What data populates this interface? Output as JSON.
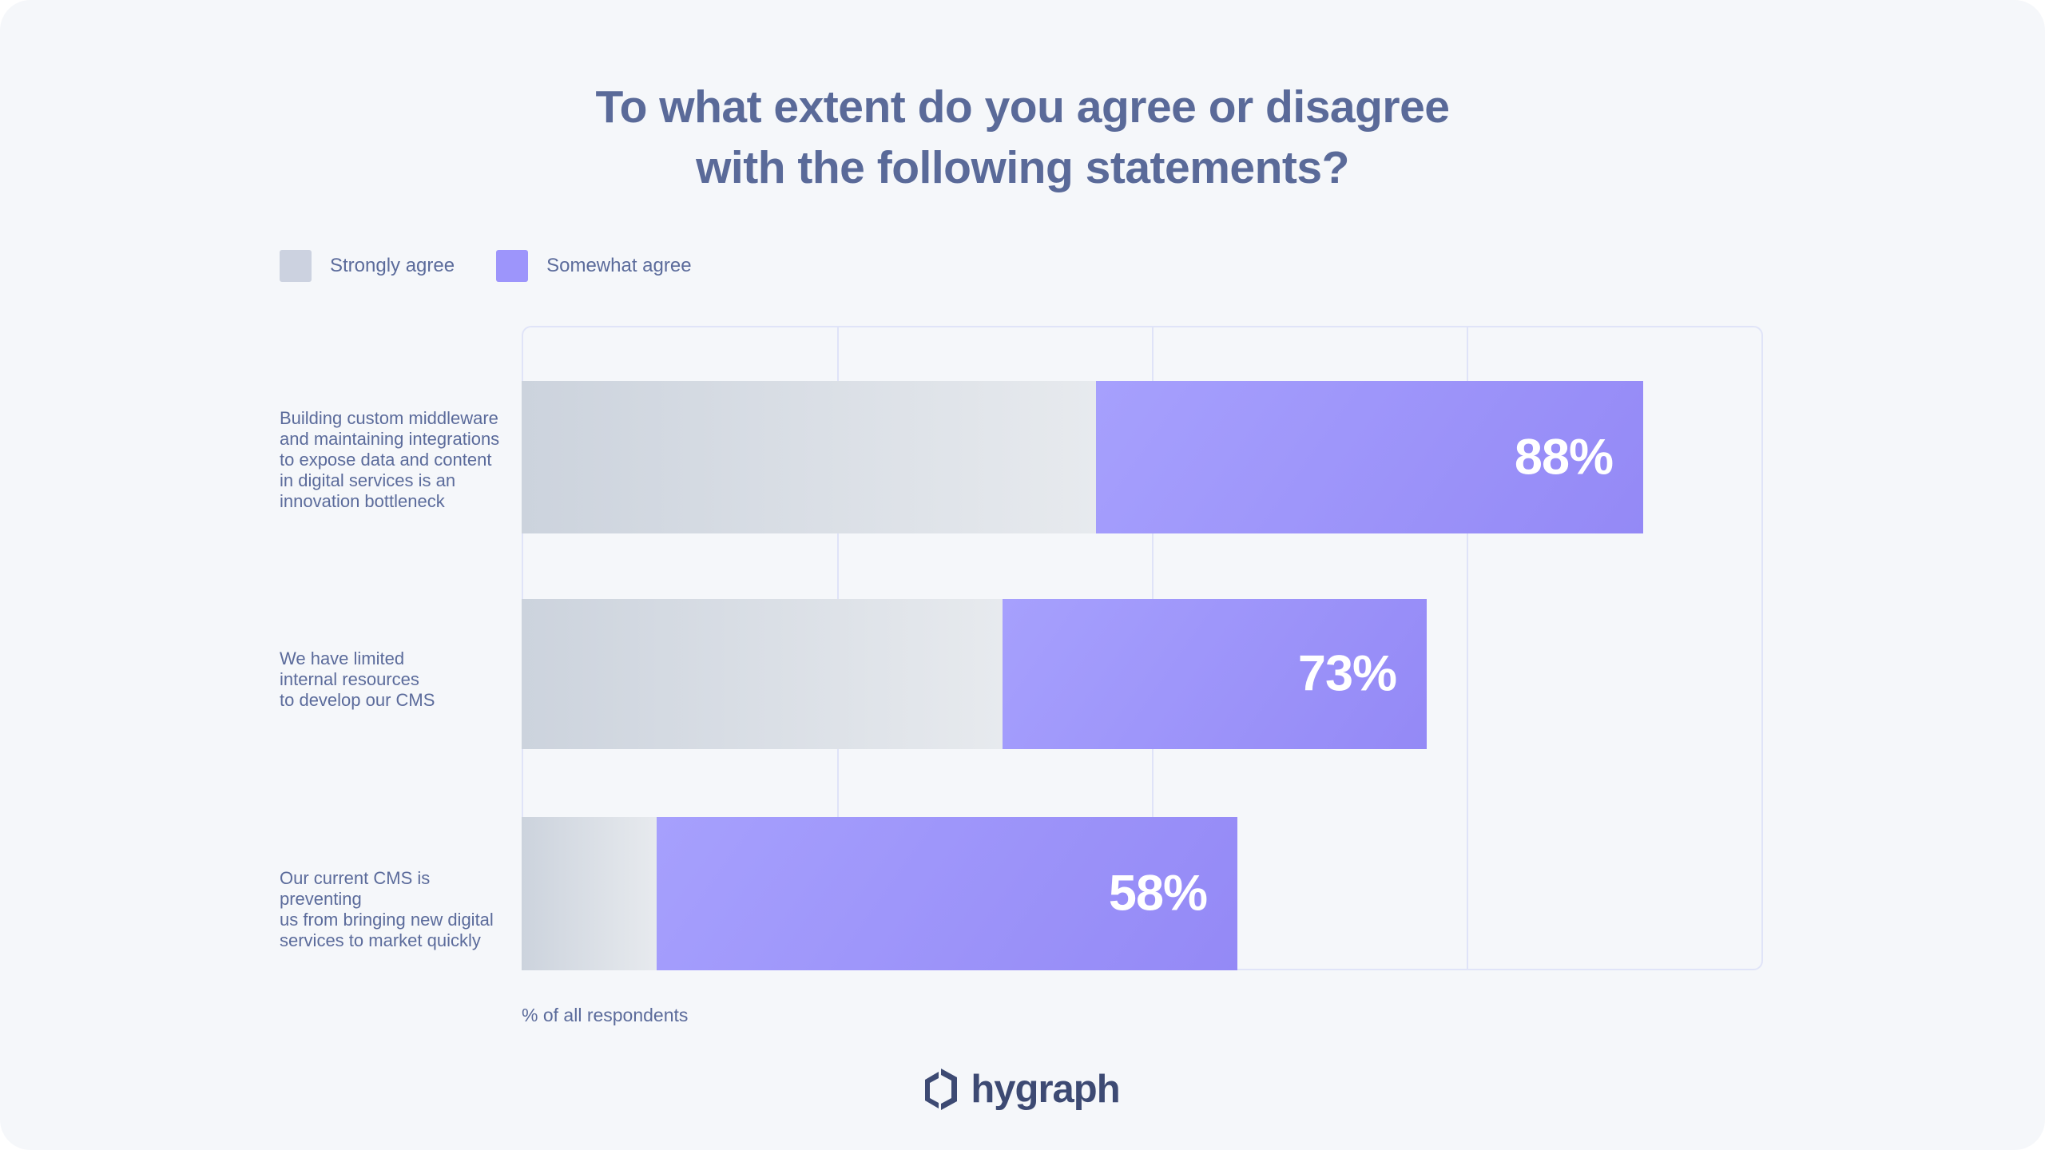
{
  "page": {
    "background_color": "#f5f7fa",
    "outer_color": "#ffffff"
  },
  "title": {
    "line1": "To what extent do you agree or disagree",
    "line2": "with the following statements?",
    "color": "#5a6a99"
  },
  "legend": {
    "items": [
      {
        "label": "Strongly agree",
        "color": "#ccd2e0",
        "icon": "square-swatch-icon"
      },
      {
        "label": "Somewhat agree",
        "color": "#9d95fb",
        "icon": "square-swatch-icon"
      }
    ]
  },
  "footnote": "% of all respondents",
  "logo": {
    "text": "hygraph",
    "icon": "hygraph-logo-icon",
    "color": "#3d4a73"
  },
  "colors": {
    "accent_purple": "#9d95fb",
    "neutral_gray": "#ccd3dd",
    "text_blue": "#5b6b9b",
    "grid": "#dfe3f8",
    "frame_border": "#e0e4f8"
  },
  "chart_data": {
    "type": "bar",
    "orientation": "horizontal",
    "stacked": true,
    "title": "To what extent do you agree or disagree with the following statements?",
    "xlabel": "% of all respondents",
    "ylabel": "",
    "xlim": [
      0,
      100
    ],
    "grid": true,
    "gridlines_x": [
      0,
      25,
      50,
      75,
      100
    ],
    "legend_position": "top-left",
    "categories": [
      "Building custom middleware and maintaining integrations to expose data and content in digital services is an innovation bottleneck",
      "We have limited internal resources to develop our  CMS",
      "Our current CMS is preventing us from bringing new digital services to market quickly"
    ],
    "series": [
      {
        "name": "Strongly agree",
        "color": "#ccd3dd",
        "values": [
          46,
          39,
          11
        ]
      },
      {
        "name": "Somewhat agree",
        "color": "#9d95fb",
        "values": [
          44,
          34,
          47
        ]
      }
    ],
    "totals": [
      88,
      73,
      58
    ],
    "data_labels": [
      "88%",
      "73%",
      "58%"
    ],
    "bars": [
      {
        "label_lines": [
          "Building custom middleware",
          "and maintaining integrations",
          "to expose data and content",
          "in digital services is an",
          "innovation bottleneck"
        ],
        "value_label": "88%",
        "total": 88,
        "strongly_agree": 46,
        "somewhat_agree": 44
      },
      {
        "label_lines": [
          "We have limited",
          "internal resources",
          "to develop our  CMS"
        ],
        "value_label": "73%",
        "total": 73,
        "strongly_agree": 39,
        "somewhat_agree": 34
      },
      {
        "label_lines": [
          "Our current CMS is preventing",
          "us from bringing new digital",
          "services to market quickly"
        ],
        "value_label": "58%",
        "total": 58,
        "strongly_agree": 11,
        "somewhat_agree": 47
      }
    ]
  }
}
